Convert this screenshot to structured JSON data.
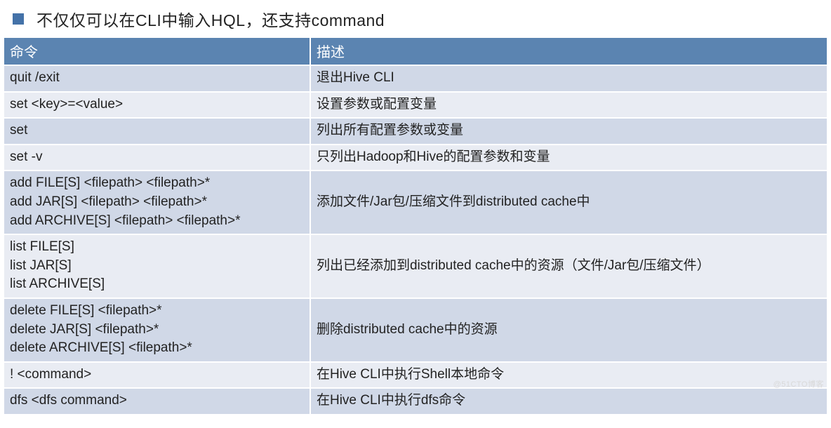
{
  "title": "不仅仅可以在CLI中输入HQL，还支持command",
  "headers": {
    "cmd": "命令",
    "desc": "描述"
  },
  "rows": [
    {
      "cmd": "quit /exit",
      "desc": "退出Hive CLI",
      "band": "a"
    },
    {
      "cmd": "set <key>=<value>",
      "desc": "设置参数或配置变量",
      "band": "b"
    },
    {
      "cmd": "set",
      "desc": "列出所有配置参数或变量",
      "band": "a"
    },
    {
      "cmd": "set -v",
      "desc": "只列出Hadoop和Hive的配置参数和变量",
      "band": "b"
    },
    {
      "cmd": "add FILE[S] <filepath> <filepath>*\nadd JAR[S] <filepath> <filepath>*\nadd ARCHIVE[S] <filepath> <filepath>*",
      "desc": "添加文件/Jar包/压缩文件到distributed cache中",
      "band": "a"
    },
    {
      "cmd": "list FILE[S]\nlist JAR[S]\nlist ARCHIVE[S]",
      "desc": "列出已经添加到distributed cache中的资源（文件/Jar包/压缩文件）",
      "band": "b"
    },
    {
      "cmd": "delete FILE[S] <filepath>*\ndelete JAR[S] <filepath>*\ndelete ARCHIVE[S] <filepath>*",
      "desc": "删除distributed cache中的资源",
      "band": "a"
    },
    {
      "cmd": "! <command>",
      "desc": "在Hive CLI中执行Shell本地命令",
      "band": "b"
    },
    {
      "cmd": "dfs <dfs command>",
      "desc": "在Hive CLI中执行dfs命令",
      "band": "a"
    }
  ],
  "watermark": "@51CTO博客"
}
